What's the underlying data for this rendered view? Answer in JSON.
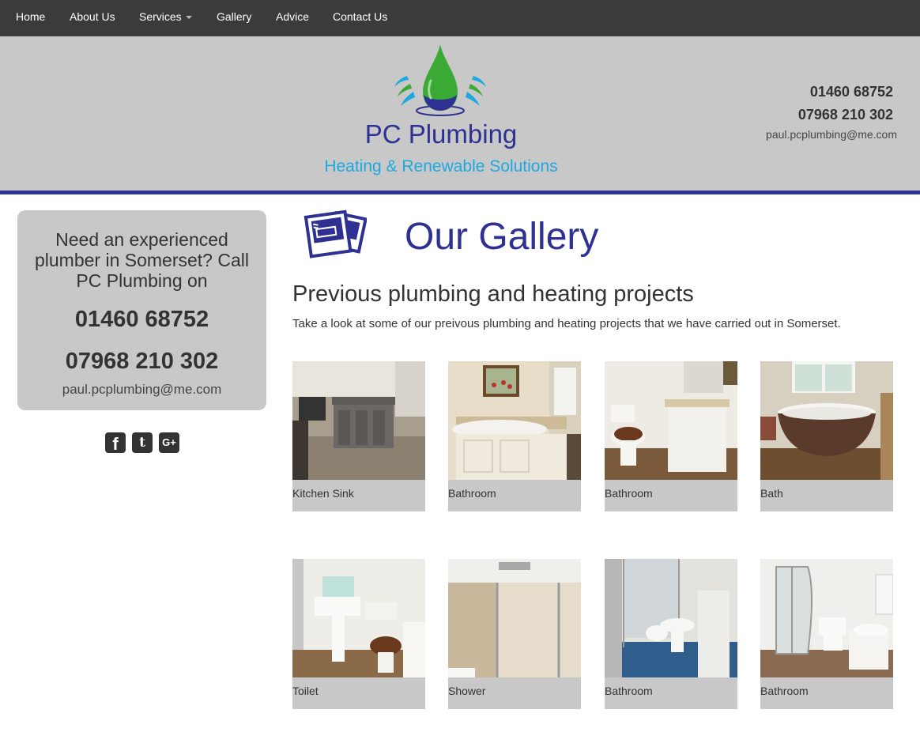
{
  "nav": {
    "items": [
      {
        "label": "Home"
      },
      {
        "label": "About Us"
      },
      {
        "label": "Services"
      },
      {
        "label": "Gallery"
      },
      {
        "label": "Advice"
      },
      {
        "label": "Contact Us"
      }
    ]
  },
  "header": {
    "logo_name": "PC Plumbing",
    "logo_tagline": "Heating & Renewable Solutions",
    "phone_1": "01460 68752",
    "phone_2": "07968 210 302",
    "email": "paul.pcplumbing@me.com"
  },
  "sidebar": {
    "intro": "Need an experienced plumber in Somerset? Call PC Plumbing on",
    "phone_1": "01460 68752",
    "phone_2": "07968 210 302",
    "email": "paul.pcplumbing@me.com",
    "social": [
      {
        "icon": "facebook-icon",
        "glyph": "f"
      },
      {
        "icon": "twitter-icon",
        "glyph": "t"
      },
      {
        "icon": "google-plus-icon",
        "glyph": "G+"
      }
    ]
  },
  "main": {
    "title": "Our Gallery",
    "heading": "Previous plumbing and heating projects",
    "intro": "Take a look at some of our preivous plumbing and heating projects that we have carried out in Somerset.",
    "gallery": [
      {
        "caption": "Kitchen Sink"
      },
      {
        "caption": "Bathroom"
      },
      {
        "caption": "Bathroom"
      },
      {
        "caption": "Bath"
      },
      {
        "caption": "Toilet"
      },
      {
        "caption": "Shower"
      },
      {
        "caption": "Bathroom"
      },
      {
        "caption": "Bathroom"
      }
    ]
  },
  "colors": {
    "brand_navy": "#2e3191",
    "brand_light_blue": "#1ea8e0",
    "brand_green": "#3aaa35",
    "nav_bg": "#3b3b3b",
    "header_bg": "#c8c8c8"
  }
}
